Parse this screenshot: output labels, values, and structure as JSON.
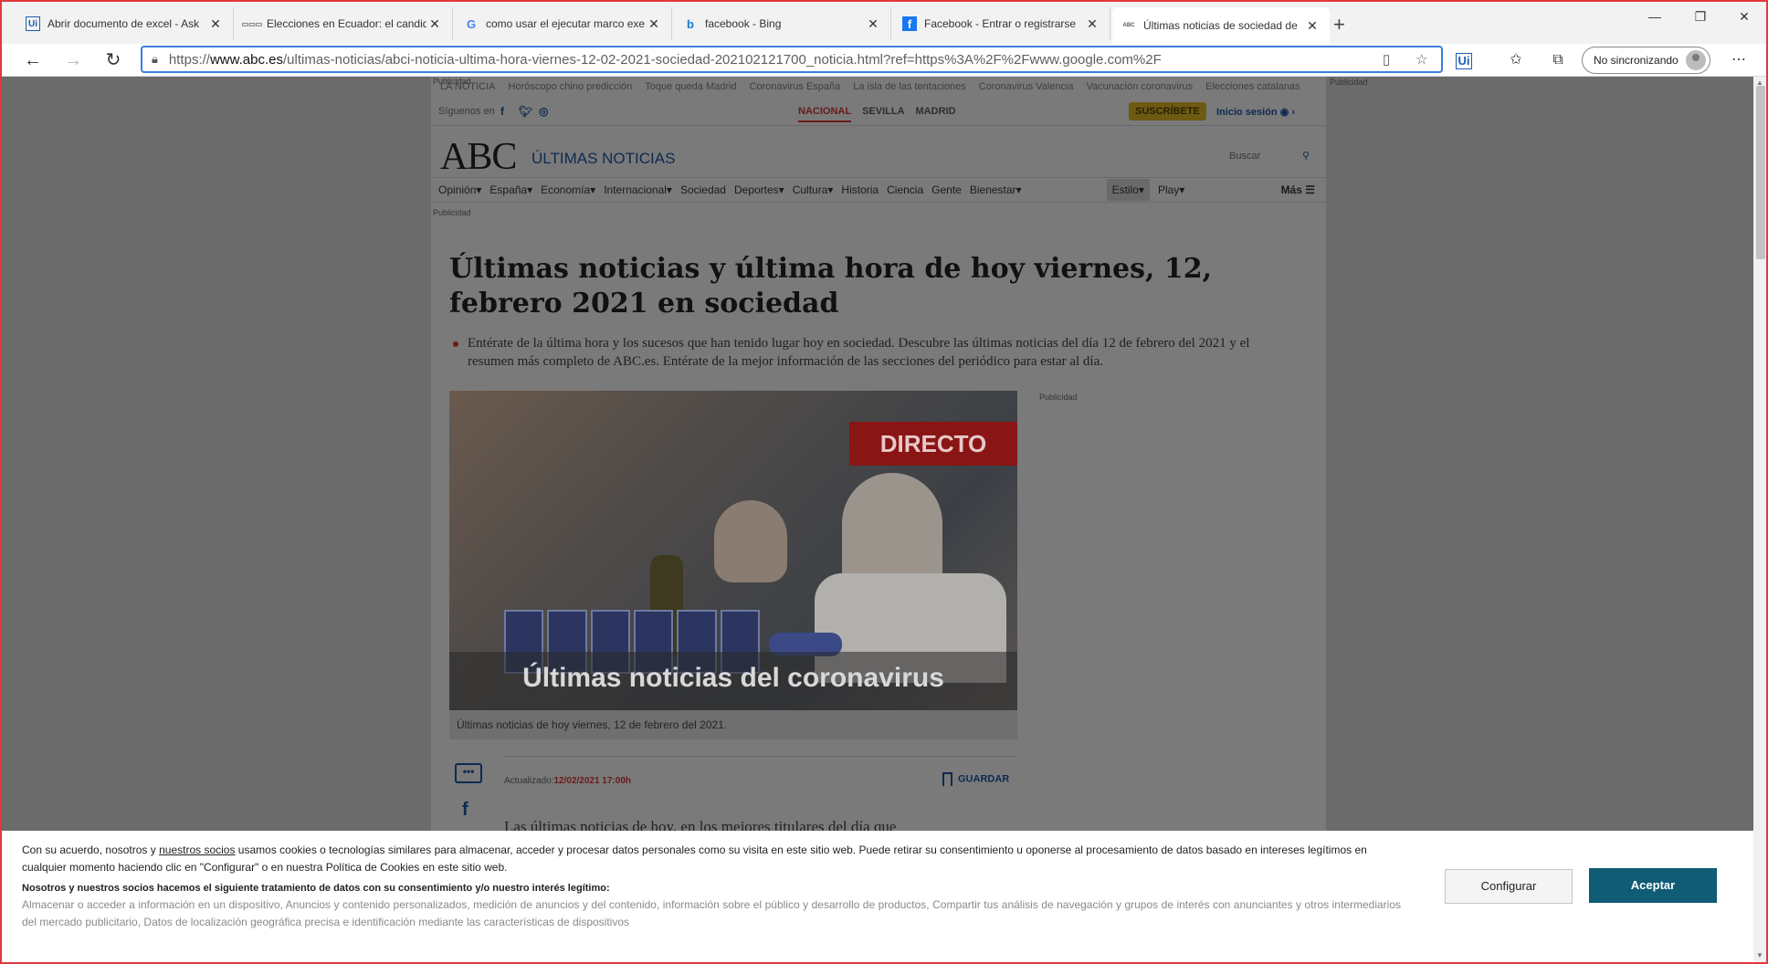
{
  "browser": {
    "tabs": [
      {
        "title": "Abrir documento de excel - Ask",
        "favicon": "Ui",
        "favicon_color": "#1a5fb4",
        "active": false
      },
      {
        "title": "Elecciones en Ecuador: el candid",
        "favicon": "▭▭▭",
        "favicon_color": "#666666",
        "active": false
      },
      {
        "title": "como usar el ejecutar marco exe",
        "favicon": "G",
        "favicon_color": "#4285f4",
        "active": false
      },
      {
        "title": "facebook - Bing",
        "favicon": "b",
        "favicon_color": "#1b7ad1",
        "active": false
      },
      {
        "title": "Facebook - Entrar o registrarse",
        "favicon": "f",
        "favicon_color": "#1877f2",
        "active": false
      },
      {
        "title": "Últimas noticias de sociedad de",
        "favicon": "ABC",
        "favicon_color": "#555555",
        "active": true
      }
    ],
    "new_tab": "+",
    "url_prefix": "https://",
    "url_domain": "www.abc.es",
    "url_path": "/ultimas-noticias/abci-noticia-ultima-hora-viernes-12-02-2021-sociedad-202102121700_noticia.html?ref=https%3A%2F%2Fwww.google.com%2F",
    "profile_label": "No sincronizando"
  },
  "page": {
    "publicidad": "Publicidad",
    "top_links": [
      "LA NOTICIA",
      "Horóscopo chino predicción",
      "Toque queda Madrid",
      "Coronavirus España",
      "La isla de las tentaciones",
      "Coronavirus Valencia",
      "Vacunación coronavirus",
      "Elecciones catalanas"
    ],
    "follow_label": "Síguenos en",
    "regions": [
      "NACIONAL",
      "SEVILLA",
      "MADRID"
    ],
    "subscribe": "SUSCRÍBETE",
    "login": "Inicio sesión",
    "logo": "ABC",
    "section": "ÚLTIMAS NOTICIAS",
    "search_placeholder": "Buscar",
    "menu": [
      "Opinión▾",
      "España▾",
      "Economía▾",
      "Internacional▾",
      "Sociedad",
      "Deportes▾",
      "Cultura▾",
      "Historia",
      "Ciencia",
      "Gente",
      "Bienestar▾"
    ],
    "menu_right": [
      "Estilo▾",
      "Play▾"
    ],
    "menu_more": "Más ☰"
  },
  "article": {
    "headline": "Últimas noticias y última hora de hoy viernes, 12, febrero 2021 en sociedad",
    "lead": "Entérate de la última hora y los sucesos que han tenido lugar hoy en sociedad. Descubre las últimas noticias del día 12 de febrero del 2021 y el resumen más completo de ABC.es. Entérate de la mejor información de las secciones del periódico para estar al día.",
    "photo_badge": "DIRECTO",
    "photo_overlay": "Últimas noticias del coronavirus",
    "photo_caption": "Últimas noticias de hoy viernes, 12 de febrero del 2021.",
    "updated_label": "Actualizado:",
    "updated_value": "12/02/2021 17:00h",
    "save_label": "GUARDAR",
    "body_start": "Las últimas noticias de hoy, en los mejores titulares del día que"
  },
  "cookie": {
    "p1_a": "Con su acuerdo, nosotros y ",
    "p1_link": "nuestros socios",
    "p1_b": " usamos cookies o tecnologías similares para almacenar, acceder y procesar datos personales como su visita en este sitio web. Puede retirar su consentimiento u oponerse al procesamiento de datos basado en intereses legítimos en cualquier momento haciendo clic en \"Configurar\" o en nuestra Política de Cookies en este sitio web.",
    "p2": "Nosotros y nuestros socios hacemos el siguiente tratamiento de datos con su consentimiento y/o nuestro interés legítimo:",
    "p3": "Almacenar o acceder a información en un dispositivo, Anuncios y contenido personalizados, medición de anuncios y del contenido, información sobre el público y desarrollo de productos, Compartir tus análisis de navegación y grupos de interés con anunciantes y otros intermediarios del mercado publicitario, Datos de localización geográfica precisa e identificación mediante las características de dispositivos",
    "configure": "Configurar",
    "accept": "Aceptar"
  }
}
